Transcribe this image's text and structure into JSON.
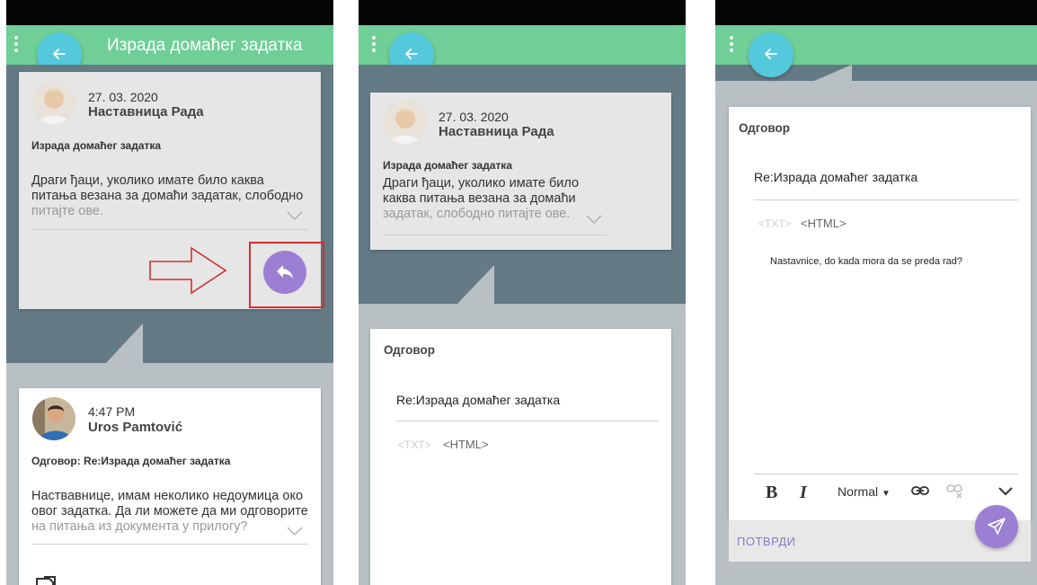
{
  "screen1": {
    "title": "Израда домаћег задатка",
    "message": {
      "date": "27. 03. 2020",
      "author": "Наставница Рада",
      "subject": "Израда домаћег задатка",
      "body_line1": "Драги ђаци, уколико имате било каква",
      "body_line2": "питања везана за домаћи задатак, слободно",
      "body_line3": "питајте ове."
    },
    "reply": {
      "time": "4:47 PM",
      "author": "Uros Pamtović",
      "subject": "Одговор: Re:Израда домаћег задатка",
      "body_line1": "Наствавнице, имам неколико недоумица око",
      "body_line2": "овог задатка. Да ли можете да ми одговорите",
      "body_line3": "на питања из документа у прилогу?"
    }
  },
  "screen2": {
    "message": {
      "date": "27. 03. 2020",
      "author": "Наставница Рада",
      "subject": "Израда домаћег задатка",
      "body_line1": "Драги ђаци, уколико имате било",
      "body_line2": "каква питања везана за домаћи",
      "body_line3": "задатак, слободно питајте ове."
    },
    "answer": {
      "heading": "Одговор",
      "subject": "Re:Израда домаћег задатка",
      "tab_txt": "<TXT>",
      "tab_html": "<HTML>"
    }
  },
  "screen3": {
    "answer": {
      "heading": "Одговор",
      "subject": "Re:Израда домаћег задатка",
      "tab_txt": "<TXT>",
      "tab_html": "<HTML>",
      "text": "Nastavnice, do kada mora da se preda rad?"
    },
    "toolbar": {
      "bold": "B",
      "italic": "I",
      "format": "Normal"
    },
    "confirm_label": "ПОТВРДИ"
  },
  "colors": {
    "appbar": "#6fcf97",
    "back_fab": "#55c9dc",
    "action_fab": "#9b7fd3",
    "highlight": "#d32f2f"
  }
}
